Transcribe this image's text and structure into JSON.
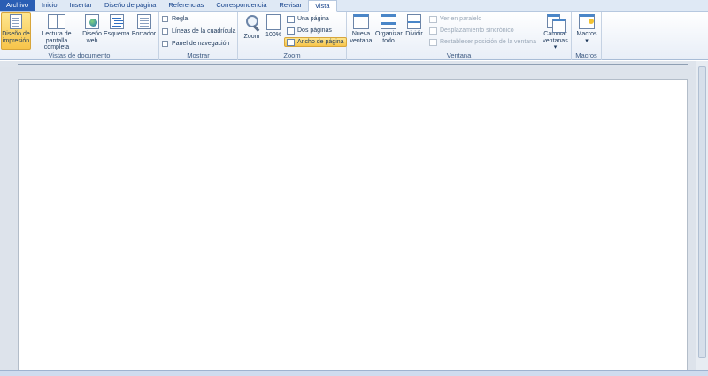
{
  "tabs": [
    {
      "label": "Archivo"
    },
    {
      "label": "Inicio"
    },
    {
      "label": "Insertar"
    },
    {
      "label": "Diseño de página"
    },
    {
      "label": "Referencias"
    },
    {
      "label": "Correspondencia"
    },
    {
      "label": "Revisar"
    },
    {
      "label": "Vista"
    }
  ],
  "groups": {
    "document_views": {
      "label": "Vistas de documento",
      "buttons": [
        {
          "label": "Diseño de\nimpresión",
          "icon": "print-layout-icon",
          "pressed": true
        },
        {
          "label": "Lectura de\npantalla completa",
          "icon": "full-screen-reading-icon"
        },
        {
          "label": "Diseño\nweb",
          "icon": "web-layout-icon"
        },
        {
          "label": "Esquema",
          "icon": "outline-icon"
        },
        {
          "label": "Borrador",
          "icon": "draft-icon"
        }
      ]
    },
    "show": {
      "label": "Mostrar",
      "checks": [
        {
          "label": "Regla",
          "checked": false
        },
        {
          "label": "Líneas de la cuadrícula",
          "checked": false
        },
        {
          "label": "Panel de navegación",
          "checked": false
        }
      ]
    },
    "zoom": {
      "label": "Zoom",
      "zoom_label": "Zoom",
      "percent_label": "100%",
      "small_buttons": [
        {
          "label": "Una página"
        },
        {
          "label": "Dos páginas"
        },
        {
          "label": "Ancho de página",
          "pressed": true
        }
      ]
    },
    "window": {
      "label": "Ventana",
      "buttons": [
        {
          "label": "Nueva\nventana",
          "icon": "new-window-icon"
        },
        {
          "label": "Organizar\ntodo",
          "icon": "arrange-all-icon"
        },
        {
          "label": "Dividir",
          "icon": "split-icon"
        }
      ],
      "small_buttons": [
        {
          "label": "Ver en paralelo",
          "disabled": true
        },
        {
          "label": "Desplazamiento sincrónico",
          "disabled": true
        },
        {
          "label": "Restablecer posición de la ventana",
          "disabled": true
        }
      ],
      "switch_label": "Cambiar\nventanas ▾"
    },
    "macros": {
      "label": "Macros",
      "button_label": "Macros\n▾"
    }
  },
  "colors": {
    "file_tab": "#2a5eb4",
    "pressed": "#f7c44a",
    "doc_background": "#dde3eb"
  }
}
